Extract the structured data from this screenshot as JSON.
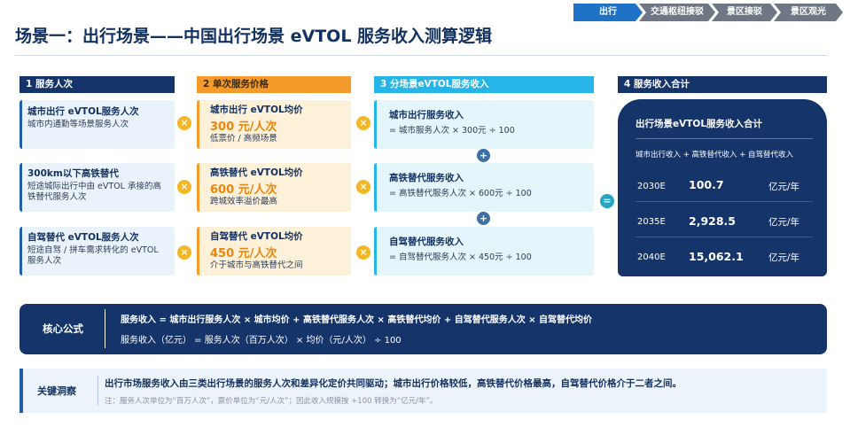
{
  "breadcrumb": [
    "出行",
    "交通枢纽接驳",
    "景区接驳",
    "景区观光"
  ],
  "title": "场景一：出行场景——中国出行场景 eVTOL 服务收入测算逻辑",
  "columns": {
    "c1": "1  服务人次",
    "c2": "2  单次服务价格",
    "c3": "3  分场景eVTOL服务收入",
    "c4": "4  服务收入合计"
  },
  "rows": [
    {
      "service_title": "城市出行 eVTOL服务人次",
      "service_desc": "城市内通勤等场景服务人次",
      "price_title": "城市出行 eVTOL均价",
      "price_value": "300 元/人次",
      "price_desc": "低票价 / 高频场景",
      "revenue_title": "城市出行服务收入",
      "revenue_formula": "= 城市服务人次 × 300元 ÷ 100"
    },
    {
      "service_title": "300km以下高铁替代",
      "service_desc": "短途城际出行中由 eVTOL 承接的高铁替代服务人次",
      "price_title": "高铁替代 eVTOL均价",
      "price_value": "600 元/人次",
      "price_desc": "跨城效率溢价最高",
      "revenue_title": "高铁替代服务收入",
      "revenue_formula": "= 高铁替代服务人次 × 600元 ÷ 100"
    },
    {
      "service_title": "自驾替代 eVTOL服务人次",
      "service_desc": "短途自驾 / 拼车需求转化的 eVTOL 服务人次",
      "price_title": "自驾替代 eVTOL均价",
      "price_value": "450 元/人次",
      "price_desc": "介于城市与高铁替代之间",
      "revenue_title": "自驾替代服务收入",
      "revenue_formula": "= 自驾替代服务人次 × 450元 ÷ 100"
    }
  ],
  "operators": {
    "times": "×",
    "plus": "+",
    "equals": "="
  },
  "total": {
    "title": "出行场景eVTOL服务收入合计",
    "subtitle": "城市出行收入 + 高铁替代收入 + 自驾替代收入",
    "rows": [
      {
        "year": "2030E",
        "value": "100.7",
        "unit": "亿元/年"
      },
      {
        "year": "2035E",
        "value": "2,928.5",
        "unit": "亿元/年"
      },
      {
        "year": "2040E",
        "value": "15,062.1",
        "unit": "亿元/年"
      }
    ]
  },
  "formula": {
    "label": "核心公式",
    "line1": "服务收入 = 城市出行服务人次 × 城市均价 + 高铁替代服务人次 × 高铁替代均价 + 自驾替代服务人次 × 自驾替代均价",
    "line2": "服务收入（亿元） = 服务人次（百万人次） × 均价（元/人次） ÷ 100"
  },
  "insight": {
    "label": "关键洞察",
    "text": "出行市场服务收入由三类出行场景的服务人次和差异化定价共同驱动；城市出行价格较低，高铁替代价格最高，自驾替代价格介于二者之间。",
    "note": "注：服务人次单位为“百万人次”，票价单位为“元/人次”；因此收入规模按 ÷100 转换为“亿元/年”。"
  },
  "colors": {
    "navy": "#14346a",
    "orange": "#f59a2b",
    "cyan": "#27b4e6",
    "price_orange": "#e8860d",
    "active_tab": "#1f73c7"
  }
}
